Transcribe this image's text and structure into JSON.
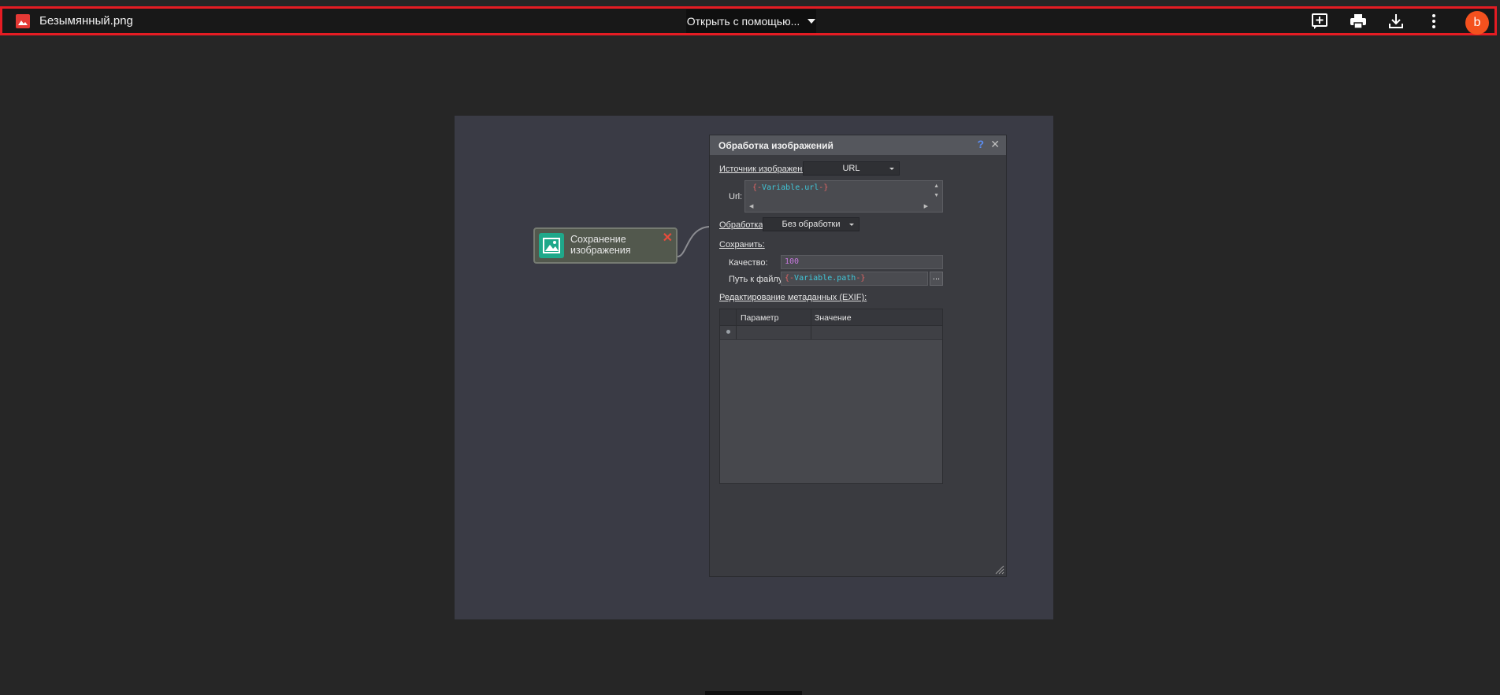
{
  "viewer": {
    "file_name": "Безымянный.png",
    "open_with_label": "Открыть с помощью...",
    "avatar_letter": "b",
    "icons": [
      "image-file-icon",
      "add-comment-icon",
      "print-icon",
      "download-icon",
      "more-vert-icon"
    ],
    "colors": {
      "border": "#e51c23",
      "avatar": "#f4511e"
    }
  },
  "node": {
    "label_line1": "Сохранение",
    "label_line2": "изображения",
    "close_glyph": "✕"
  },
  "dialog": {
    "title": "Обработка изображений",
    "help_glyph": "?",
    "close_glyph": "✕",
    "source_label": "Источник изображения:",
    "source_value": "URL",
    "url_label": "Url:",
    "url_value": {
      "open": "{-",
      "var": "Variable.url",
      "close": "-}"
    },
    "processing_label": "Обработка:",
    "processing_value": "Без обработки",
    "save_label": "Сохранить:",
    "quality_label": "Качество:",
    "quality_value": "100",
    "path_label": "Путь к файлу:",
    "path_value": {
      "open": "{-",
      "var": "Variable.path",
      "close": "-}"
    },
    "browse_label": "...",
    "exif_label": "Редактирование метаданных (EXIF):",
    "grid": {
      "columns": [
        "Параметр",
        "Значение"
      ],
      "rows": []
    }
  }
}
